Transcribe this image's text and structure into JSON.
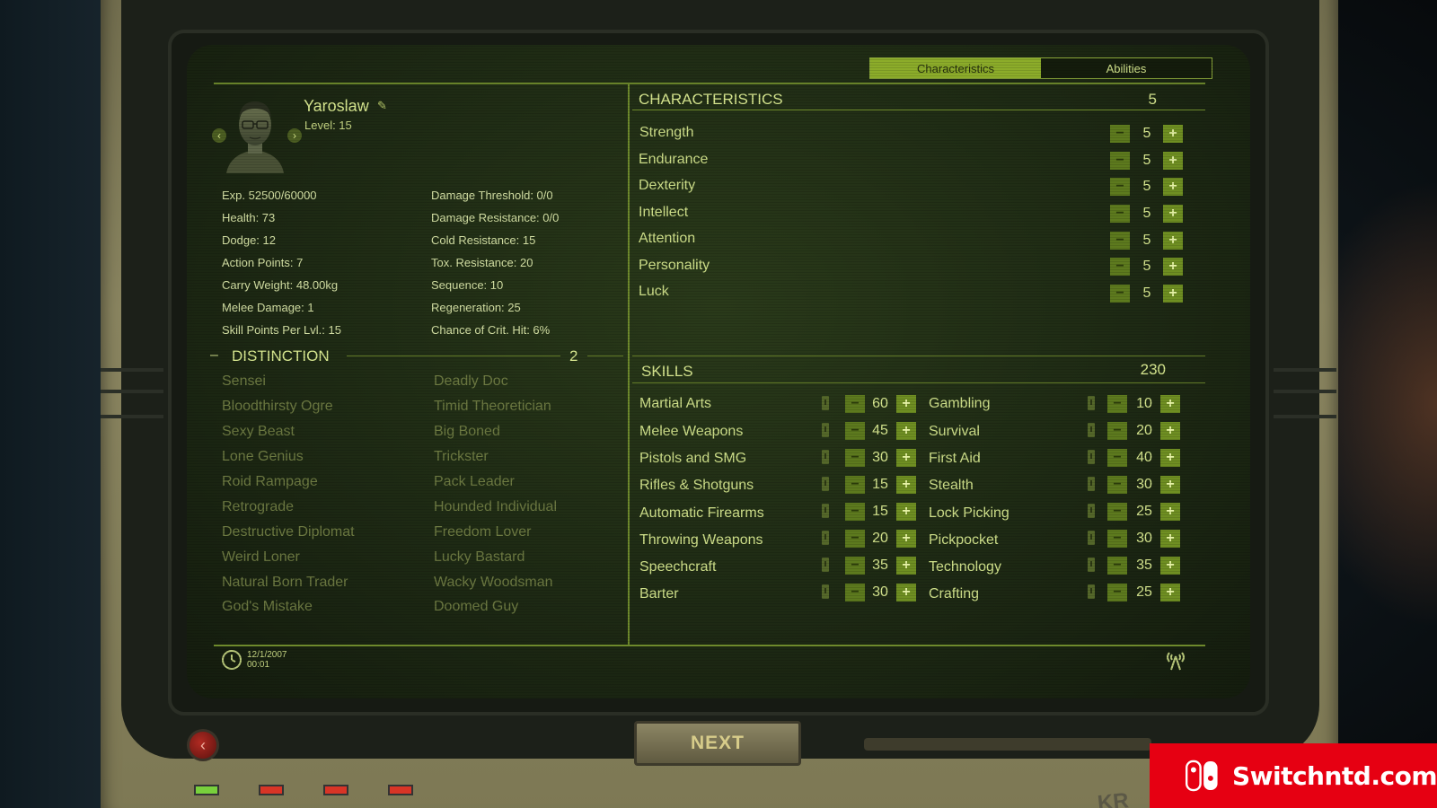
{
  "tabs": [
    {
      "label": "Characteristics",
      "active": true
    },
    {
      "label": "Abilities",
      "active": false
    }
  ],
  "character": {
    "name": "Yaroslaw",
    "level": "Level: 15"
  },
  "stats_left": [
    "Exp. 52500/60000",
    "Health: 73",
    "Dodge: 12",
    "Action Points: 7",
    "Carry Weight: 48.00kg",
    "Melee Damage: 1",
    "Skill Points Per Lvl.: 15"
  ],
  "stats_right": [
    "Damage Threshold: 0/0",
    "Damage Resistance: 0/0",
    "Cold Resistance: 15",
    "Tox. Resistance: 20",
    "Sequence: 10",
    "Regeneration: 25",
    "Chance of Crit. Hit: 6%"
  ],
  "distinction": {
    "dash": "–",
    "title": "DISTINCTION",
    "count": "2",
    "left": [
      "Sensei",
      "Bloodthirsty Ogre",
      "Sexy Beast",
      "Lone Genius",
      "Roid Rampage",
      "Retrograde",
      "Destructive Diplomat",
      "Weird Loner",
      "Natural Born Trader",
      "God's Mistake"
    ],
    "right": [
      "Deadly Doc",
      "Timid Theoretician",
      "Big Boned",
      "Trickster",
      "Pack Leader",
      "Hounded Individual",
      "Freedom Lover",
      "Lucky Bastard",
      "Wacky Woodsman",
      "Doomed Guy"
    ]
  },
  "characteristics": {
    "title": "CHARACTERISTICS",
    "points": "5",
    "items": [
      {
        "label": "Strength",
        "value": "5"
      },
      {
        "label": "Endurance",
        "value": "5"
      },
      {
        "label": "Dexterity",
        "value": "5"
      },
      {
        "label": "Intellect",
        "value": "5"
      },
      {
        "label": "Attention",
        "value": "5"
      },
      {
        "label": "Personality",
        "value": "5"
      },
      {
        "label": "Luck",
        "value": "5"
      }
    ]
  },
  "skills": {
    "title": "SKILLS",
    "points": "230",
    "left": [
      {
        "label": "Martial Arts",
        "value": "60"
      },
      {
        "label": "Melee Weapons",
        "value": "45"
      },
      {
        "label": "Pistols and SMG",
        "value": "30"
      },
      {
        "label": "Rifles & Shotguns",
        "value": "15"
      },
      {
        "label": "Automatic Firearms",
        "value": "15"
      },
      {
        "label": "Throwing Weapons",
        "value": "20"
      },
      {
        "label": "Speechcraft",
        "value": "35"
      },
      {
        "label": "Barter",
        "value": "30"
      }
    ],
    "right": [
      {
        "label": "Gambling",
        "value": "10"
      },
      {
        "label": "Survival",
        "value": "20"
      },
      {
        "label": "First Aid",
        "value": "40"
      },
      {
        "label": "Stealth",
        "value": "30"
      },
      {
        "label": "Lock Picking",
        "value": "25"
      },
      {
        "label": "Pickpocket",
        "value": "30"
      },
      {
        "label": "Technology",
        "value": "35"
      },
      {
        "label": "Crafting",
        "value": "25"
      }
    ]
  },
  "buttons": {
    "minus": "−",
    "plus": "+",
    "prev": "‹",
    "next_arrow": "›",
    "back": "‹"
  },
  "footer": {
    "date": "12/1/2007",
    "time": "00:01"
  },
  "next_label": "NEXT",
  "hardware_text": "KR",
  "watermark": "Switchntd.com",
  "colors": {
    "accent": "#8cac2a",
    "text": "#cfe08a",
    "muted_trait": "#6d7a42",
    "watermark_red": "#e60012"
  },
  "icons": {
    "edit": "pencil-icon",
    "clock": "clock-icon",
    "signal": "signal-icon",
    "logo": "switch-logo-icon"
  }
}
